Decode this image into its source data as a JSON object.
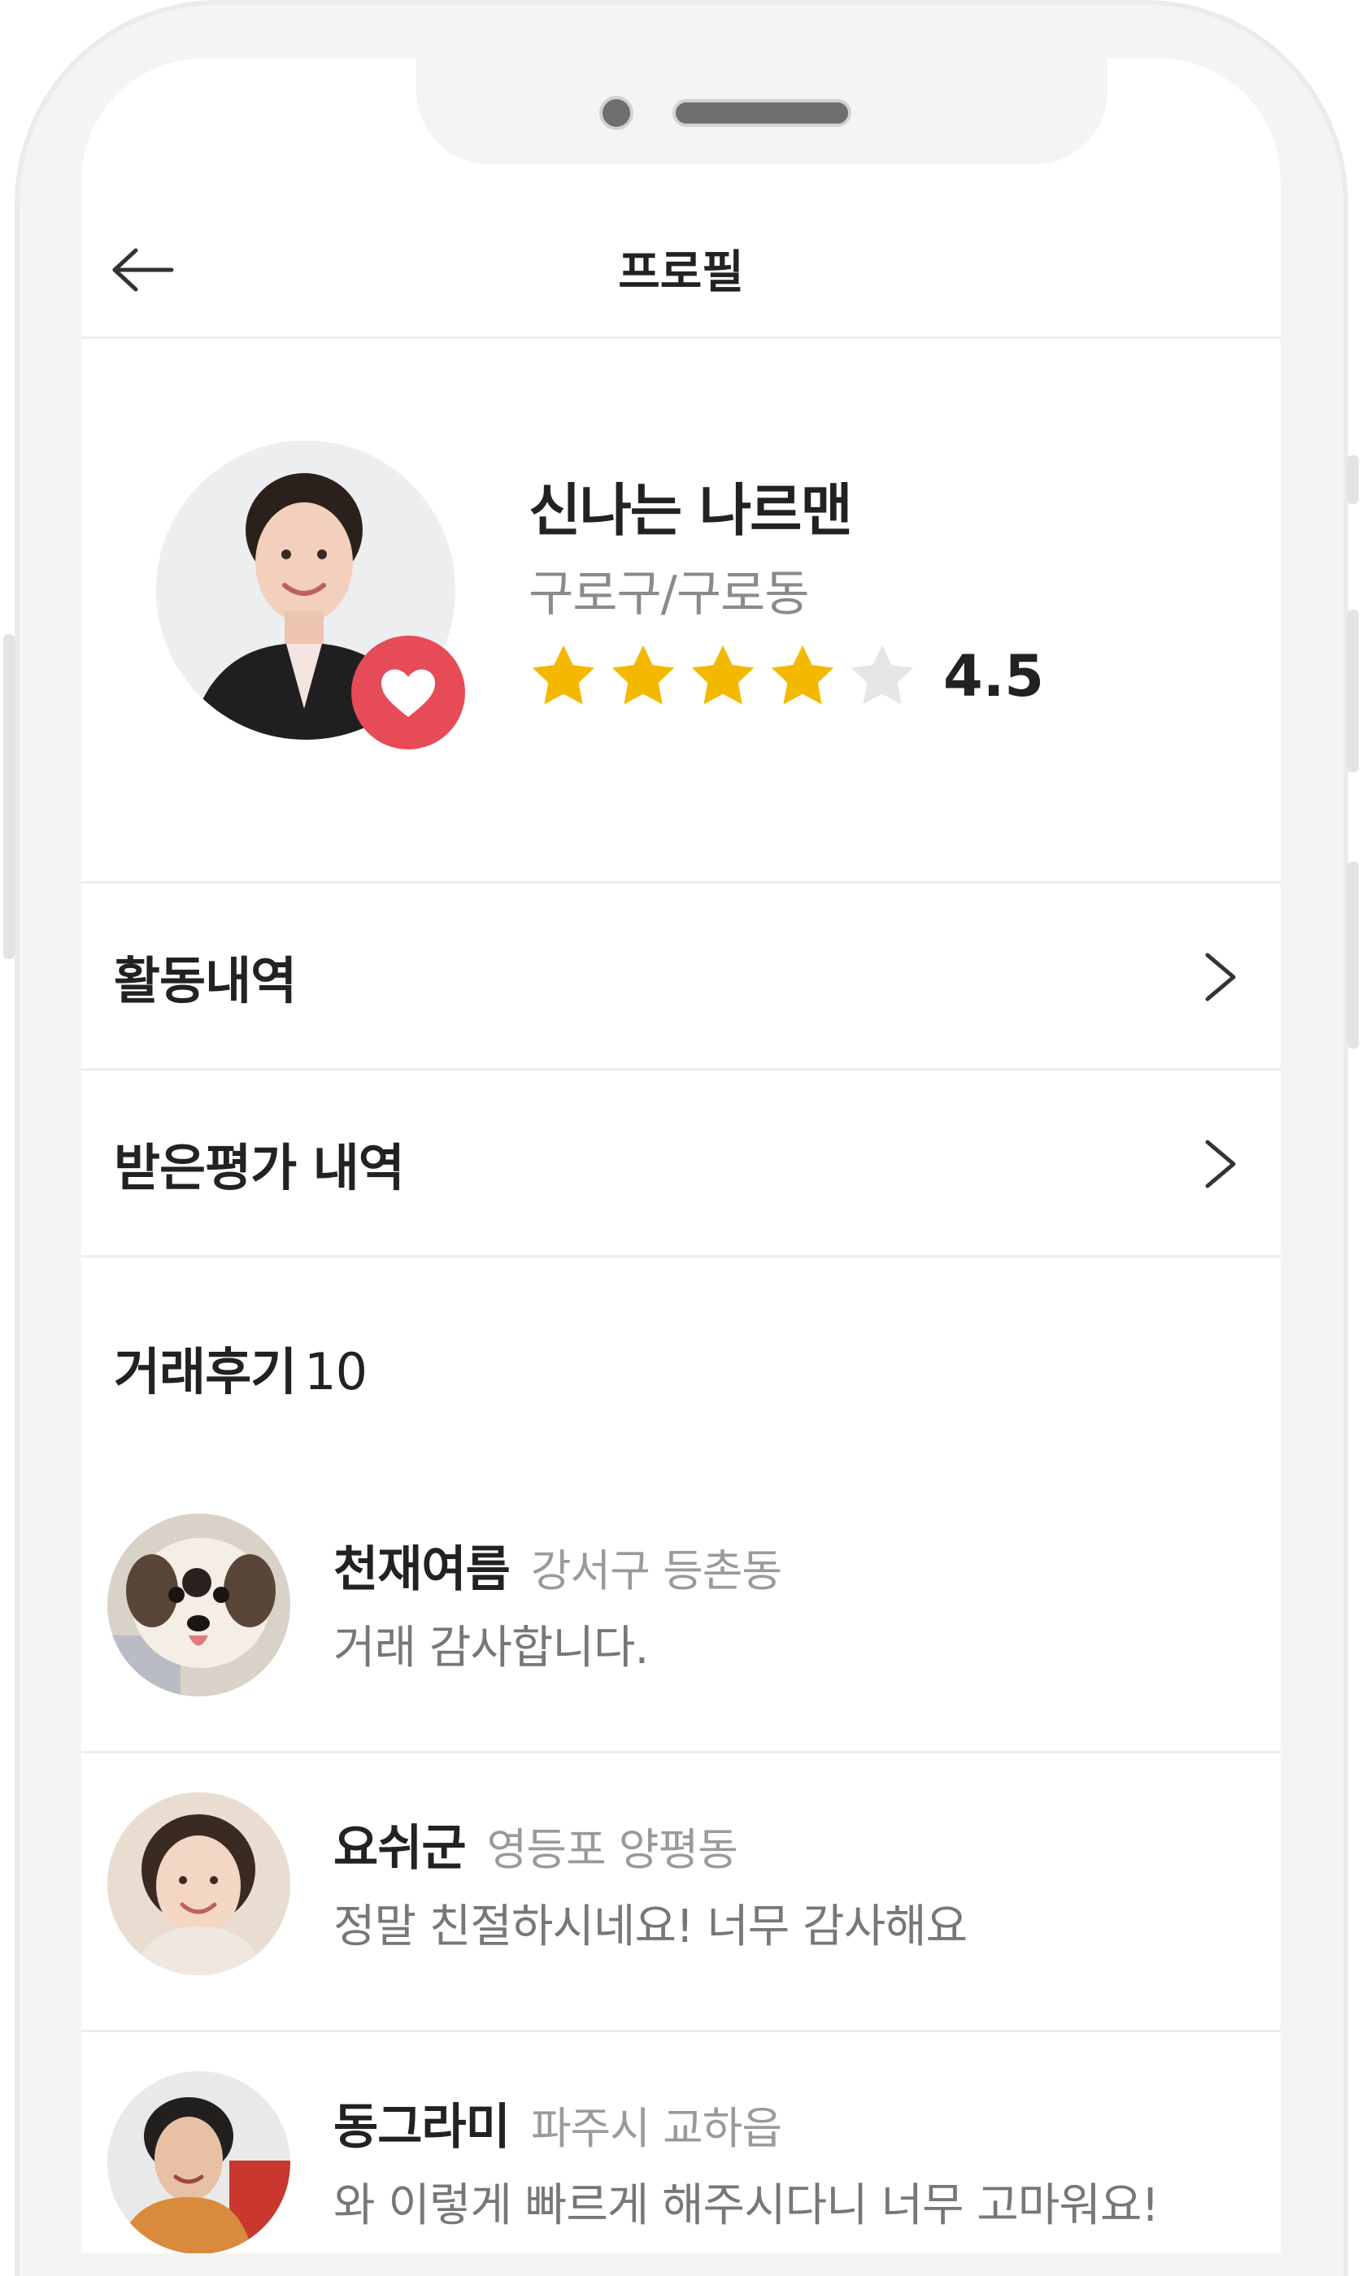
{
  "header": {
    "title": "프로필",
    "back_icon": "arrow-left-icon"
  },
  "profile": {
    "nickname": "신나는 나르맨",
    "location": "구로구/구로동",
    "rating_value": "4.5",
    "rating_stars_filled": 4,
    "rating_stars_total": 5,
    "badge_icon": "heart-icon"
  },
  "menu": {
    "items": [
      {
        "label": "활동내역",
        "icon": "chevron-right-icon"
      },
      {
        "label": "받은평가 내역",
        "icon": "chevron-right-icon"
      }
    ]
  },
  "reviews": {
    "title": "거래후기",
    "count": "10",
    "items": [
      {
        "name": "천재여름",
        "location": "강서구 등촌동",
        "text": "거래 감사합니다."
      },
      {
        "name": "요쉬군",
        "location": "영등포 양평동",
        "text": "정말 친절하시네요! 너무 감사해요"
      },
      {
        "name": "동그라미",
        "location": "파주시 교하읍",
        "text": "와 이렇게 빠르게 해주시다니 너무 고마워요!"
      }
    ]
  },
  "colors": {
    "star_filled": "#f5b800",
    "star_empty": "#e6e6e6",
    "heart_badge": "#e64b57",
    "divider": "#ededed"
  }
}
